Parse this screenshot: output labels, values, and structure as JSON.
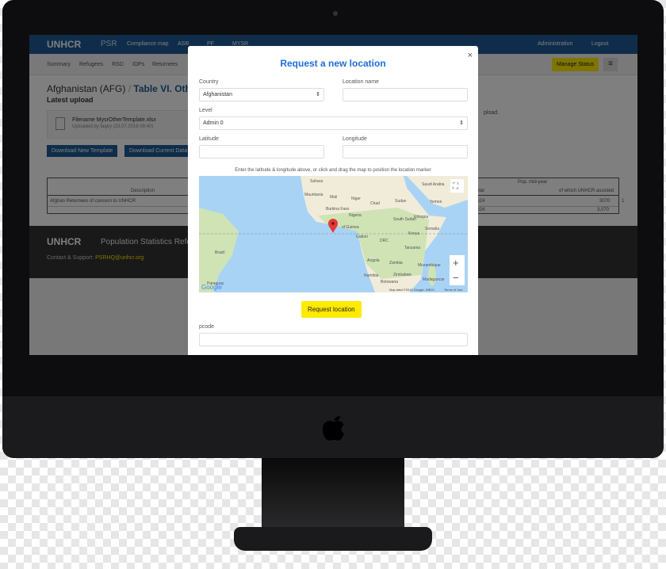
{
  "app": {
    "logo": "UNHCR",
    "product": "PSR",
    "nav": [
      "Compliance map",
      "ASR",
      "PF",
      "MYSR"
    ],
    "admin": "Administration",
    "logout": "Logout"
  },
  "subnav": [
    "Summary",
    "Refugees",
    "RSD",
    "IDPs",
    "Returnees"
  ],
  "manage_status": "Manage Status",
  "page": {
    "country": "Afghanistan (AFG)",
    "separator": "/",
    "table_title": "Table VI. Other",
    "latest_upload": "Latest upload",
    "filename": "Filename MysrOtherTemplate.xlsx",
    "uploaded_by": "Uploaded by faqiry (23.07.2019 08:40)",
    "upload_note": "pload.",
    "download_template": "Download New Template",
    "download_data": "Download Current Data"
  },
  "table": {
    "group_header": "Pop. mid-year",
    "headers": [
      "Description",
      "Total",
      "of which UNHCR assisted"
    ],
    "rows": [
      {
        "description": "Afghan Returnees of concern to UNHCR",
        "total": "3624",
        "assisted": "3070",
        "extra": "1"
      },
      {
        "description": "",
        "total": "3624",
        "assisted": "3,070",
        "extra": ""
      }
    ]
  },
  "footer": {
    "logo": "UNHCR",
    "title": "Population Statistics Reference",
    "contact_label": "Contact & Support:",
    "contact_email": "PSRHQ@unhcr.org"
  },
  "modal": {
    "title": "Request a new location",
    "close": "×",
    "country_label": "Country",
    "country_value": "Afghanistan",
    "location_label": "Location name",
    "location_value": "",
    "level_label": "Level",
    "level_value": "Admin 0",
    "lat_label": "Latitude",
    "lat_value": "",
    "lon_label": "Longitude",
    "lon_value": "",
    "hint": "Enter the latitude & longitude above, or click and drag the map to position the location marker",
    "submit": "Request location",
    "pcode_label": "pcode",
    "pcode_value": ""
  },
  "map": {
    "labels": [
      "Sahara",
      "Mauritania",
      "Mali",
      "Niger",
      "Chad",
      "Sudan",
      "Saudi Arabia",
      "Yemen",
      "Burkina Faso",
      "Nigeria",
      "South Sudan",
      "Ethiopia",
      "Somalia",
      "Kenya",
      "Gabon",
      "DRC",
      "Tanzania",
      "Brazil",
      "Angola",
      "Zambia",
      "Mozambique",
      "Namibia",
      "Zimbabwe",
      "Botswana",
      "Madagascar",
      "Paraguay",
      "of Guinea"
    ],
    "attribution": "Map data ©2019 Google, INEGI",
    "terms": "Terms of Use",
    "google": "Google",
    "zoom_in": "+",
    "zoom_out": "−",
    "colors": {
      "ocean": "#a9d3f5",
      "land": "#f1ecd9",
      "green": "#cfe3b5",
      "marker": "#e53935"
    }
  },
  "colors": {
    "brand": "#1f5a96",
    "accent": "#ffea00",
    "title": "#1e6fd9"
  }
}
